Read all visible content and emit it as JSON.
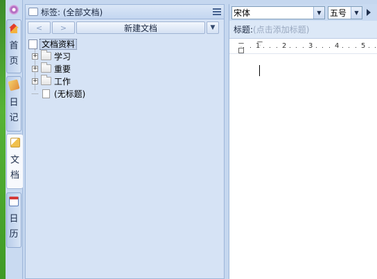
{
  "rail": {
    "tabs": [
      {
        "label_1": "首",
        "label_2": "页",
        "icon": "home-icon"
      },
      {
        "label_1": "日",
        "label_2": "记",
        "icon": "diary-icon"
      },
      {
        "label_1": "文",
        "label_2": "档",
        "icon": "document-icon"
      },
      {
        "label_1": "日",
        "label_2": "历",
        "icon": "calendar-icon"
      }
    ],
    "active_tab": "文档"
  },
  "panel": {
    "title": "标签: (全部文档)",
    "new_doc_label": "新建文档",
    "prev_label": "<",
    "next_label": ">",
    "dropdown_label": "▼",
    "tree": {
      "root": "文档资料",
      "items": [
        {
          "label": "学习",
          "expand": "+"
        },
        {
          "label": "重要",
          "expand": "+"
        },
        {
          "label": "工作",
          "expand": "+"
        },
        {
          "label": "(无标题)"
        }
      ]
    }
  },
  "editor": {
    "font": "宋体",
    "font_size": "五号",
    "arrow": "▼",
    "title_label": "标题:",
    "title_placeholder": "(点击添加标题)",
    "ruler_numbers": [
      "1",
      "2",
      "3",
      "4",
      "5"
    ]
  }
}
